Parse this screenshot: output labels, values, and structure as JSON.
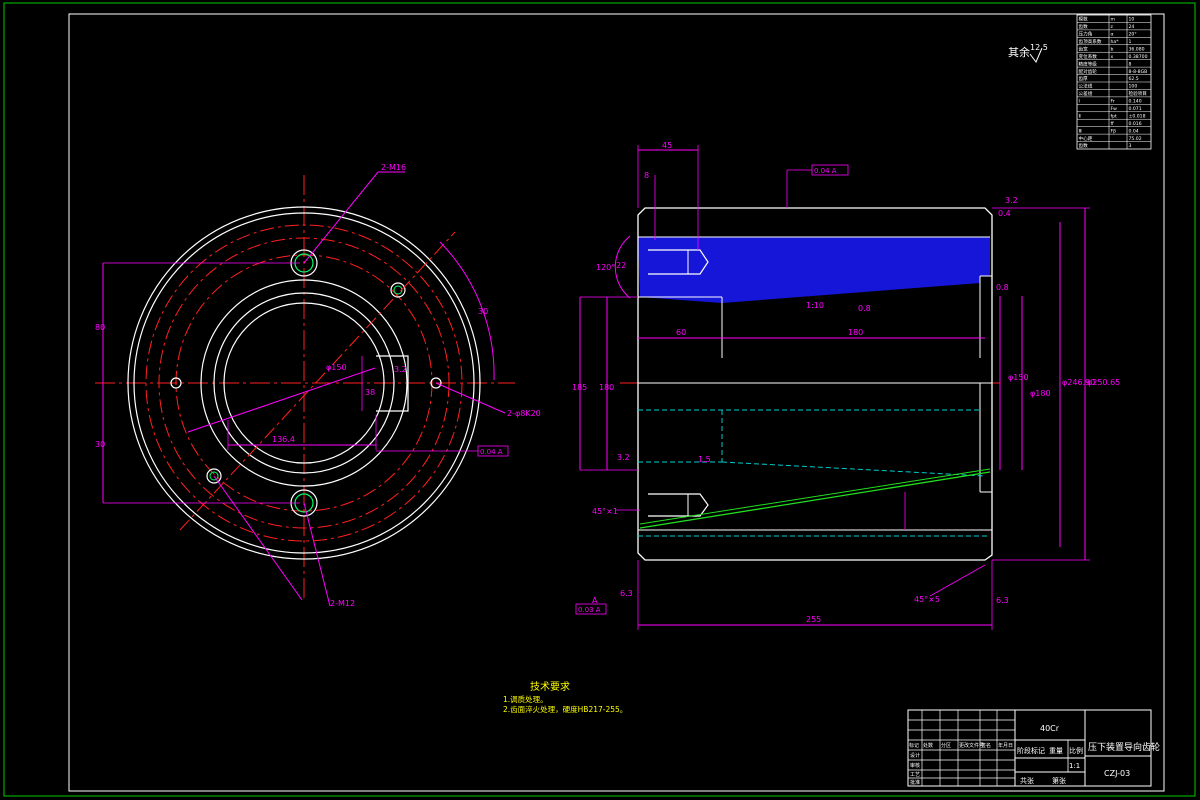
{
  "colors": {
    "background": "#000000",
    "frame": "#00cc00",
    "outline": "#ffffff",
    "center_line": "#ff2020",
    "dimension": "#ff00ff",
    "hidden": "#00cccc",
    "hatch": "#1a1aff",
    "taper": "#20e020",
    "notes": "#ffff00",
    "holes": "#00ff66"
  },
  "surface_note": {
    "label": "其余",
    "value": "12.5"
  },
  "left_view": {
    "thread_top": "2-M16",
    "thread_bottom": "2-M12",
    "pin_holes": "2-φ8K20",
    "dim_80": "80",
    "dim_30": "30",
    "dim_150": "φ150",
    "dim_136": "136.4",
    "dim_38": "38",
    "dim_3_2": "3.2",
    "dim_angle": "30",
    "tolerance_box": "0.04 A"
  },
  "section_view": {
    "dim_45_top": "45",
    "dim_8": "8",
    "dim_120deg": "120°",
    "dim_22": "22",
    "taper": "1:10",
    "ra_mid": "0.8",
    "ra_top": "3.2",
    "ra_top2": "0.4",
    "ra_right": "0.8",
    "dim_60": "60",
    "dim_180": "180",
    "dim_185": "185",
    "dim_180b": "180",
    "dim_150b": "φ150",
    "dim_180c": "φ180",
    "dim_246": "φ246.90",
    "dim_250": "φ250.65",
    "chamfer_left": "45°×1",
    "chamfer_right": "45°×5",
    "dim_255": "255",
    "ra_bottom_left": "6.3",
    "ra_bottom_right": "6.3",
    "ra_left": "3.2",
    "tolerance_top": "0.04 A",
    "datum": "A",
    "datum_box": "0.03 A",
    "taper_note": "1.5"
  },
  "param_table": {
    "rows": [
      [
        "模数",
        "m",
        "10"
      ],
      [
        "齿数",
        "z",
        "24"
      ],
      [
        "压力角",
        "α",
        "20°"
      ],
      [
        "齿顶高系数",
        "ha*",
        "1"
      ],
      [
        "齿宽",
        "b",
        "36.080"
      ],
      [
        "变位系数",
        "x",
        "0.38700"
      ],
      [
        "精度等级",
        "",
        "8"
      ],
      [
        "配对齿轮",
        "",
        "8-8-8GB"
      ],
      [
        "齿厚",
        "",
        "62.5"
      ],
      [
        "公法线",
        "",
        "100"
      ],
      [
        "公差组",
        "",
        "检验项目"
      ],
      [
        "Ⅰ",
        "Fr",
        "0.140"
      ],
      [
        "",
        "Fw",
        "0.071"
      ],
      [
        "Ⅱ",
        "fpt",
        "±0.018"
      ],
      [
        "",
        "ff",
        "0.016"
      ],
      [
        "Ⅲ",
        "Fβ",
        "0.04"
      ],
      [
        "中心距",
        "",
        "75.02"
      ],
      [
        "齿数",
        "",
        "3"
      ]
    ]
  },
  "notes": {
    "title": "技术要求",
    "line1": "1.调质处理。",
    "line2": "2.齿面淬火处理，硬度HB217-255。"
  },
  "title_block": {
    "material": "40Cr",
    "part_name": "压下装置导向齿轮",
    "stage_label": "阶段标记",
    "weight_label": "重量",
    "scale_label": "比例",
    "scale": "1:1",
    "sheet_label": "共张",
    "sheet_of": "第张",
    "drawing_no": "CZJ-03",
    "rev_headers": [
      "标记",
      "处数",
      "分区",
      "更改文件号",
      "签名",
      "年月日"
    ],
    "roles": [
      "设计",
      "审核",
      "工艺",
      "批准"
    ]
  }
}
